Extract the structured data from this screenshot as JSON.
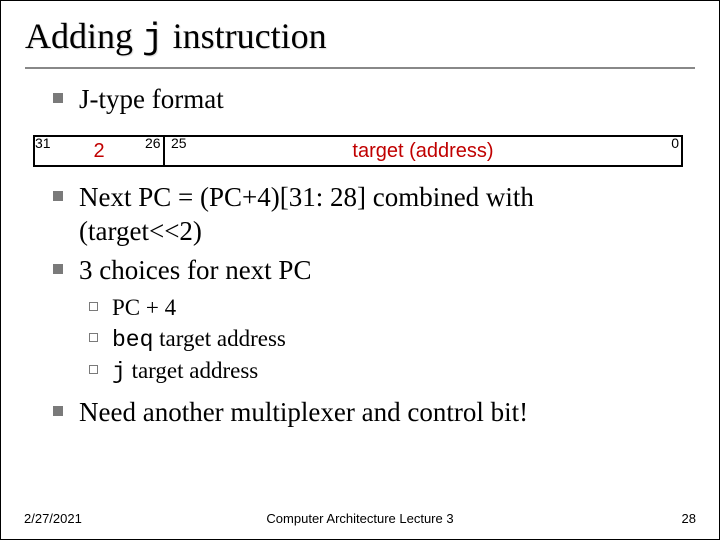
{
  "title_pre": "Adding ",
  "title_code": "j",
  "title_post": " instruction",
  "bullets": {
    "b1": "J-type format",
    "b2a": "Next PC = (PC+4)[31: 28] combined with",
    "b2b": "(target<<2)",
    "b3": "3 choices for next PC",
    "b4": "Need another multiplexer and control bit!"
  },
  "sub": {
    "s1": "PC + 4",
    "s2_code": "beq",
    "s2_rest": " target address",
    "s3_code": "j",
    "s3_rest": " target address"
  },
  "fmt": {
    "bit31": "31",
    "bit26": "26",
    "bit25": "25",
    "bit0": "0",
    "opcode": "2",
    "target": "target (address)"
  },
  "footer": {
    "date": "2/27/2021",
    "center": "Computer Architecture Lecture 3",
    "page": "28"
  }
}
